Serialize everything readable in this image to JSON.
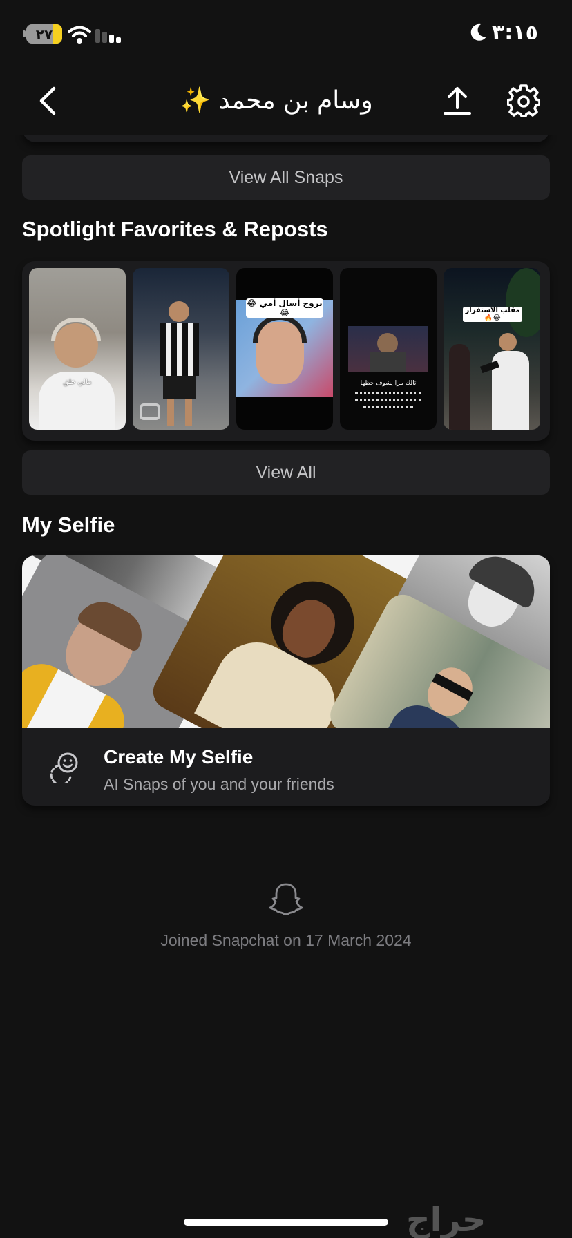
{
  "status_bar": {
    "time": "٣:١٥",
    "battery": "٢٧",
    "battery_level": 0.27
  },
  "header": {
    "title": "وسام بن محمد ✨",
    "icons": [
      "chevron-left-icon",
      "upload-icon",
      "gear-icon"
    ]
  },
  "snaps": {
    "view_all_label": "View All Snaps"
  },
  "spotlight": {
    "title": "Spotlight Favorites & Reposts",
    "view_all_label": "View All",
    "tiles": [
      {
        "caption": "مالي خلق"
      },
      {
        "caption": ""
      },
      {
        "caption": "بروج أسال أمي 😂😂"
      },
      {
        "caption": "تالك مرا يشوف حظها"
      },
      {
        "caption": "مقلب الاستفزاز 😂🔥"
      }
    ]
  },
  "selfie": {
    "title": "My Selfie",
    "create_title": "Create My Selfie",
    "create_subtitle": "AI Snaps of you and your friends"
  },
  "footer": {
    "joined_text": "Joined Snapchat on 17 March 2024",
    "watermark": "حراج"
  },
  "colors": {
    "background": "#121212",
    "card": "#1c1c1e",
    "button": "#222224",
    "battery_accent": "#f5d020"
  }
}
